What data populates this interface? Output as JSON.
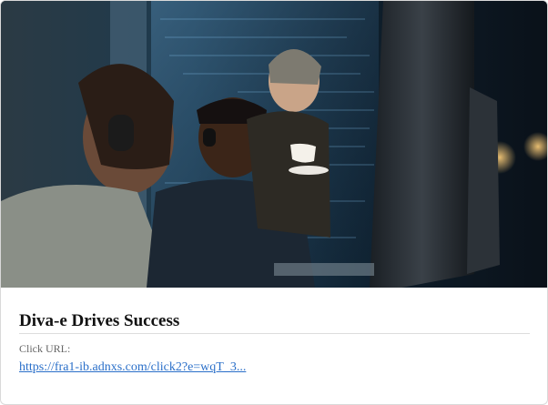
{
  "ad": {
    "headline": "Diva-e Drives Success",
    "url_label": "Click URL:",
    "url_text": "https://fra1-ib.adnxs.com/click2?e=wqT_3...",
    "image_icon": "team-at-monitors-photo"
  },
  "colors": {
    "link": "#2a6fc9",
    "headline": "#111111",
    "label": "#666666",
    "border": "#d9d9d9"
  }
}
